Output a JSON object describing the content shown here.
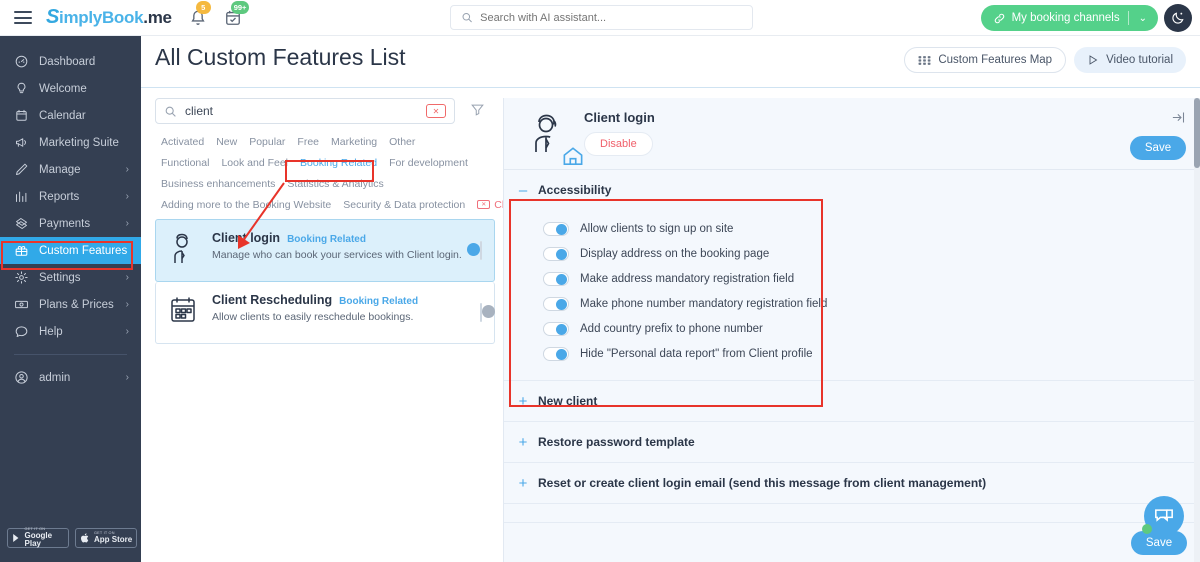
{
  "topbar": {
    "menu_icon": "hamburger-icon",
    "logo": {
      "s": "S",
      "blue": "imply",
      "dark": "Book",
      "blue2": ".",
      "dark2": "me"
    },
    "logo_text": "SimplyBook.me",
    "bell_icon": "bell-icon",
    "bell_badge": "5",
    "calendar_icon": "calendar-check-icon",
    "calendar_badge": "99+",
    "search": {
      "placeholder": "Search with AI assistant...",
      "value": "",
      "icon": "search-icon"
    },
    "booking_channels": {
      "label": "My booking channels",
      "icon": "link-icon",
      "chevron": "⌄"
    },
    "theme_toggle": {
      "icon": "moon-icon"
    }
  },
  "sidebar": {
    "items": [
      {
        "label": "Dashboard",
        "icon": "speedometer-icon",
        "chevron": false,
        "active": false
      },
      {
        "label": "Welcome",
        "icon": "lightbulb-icon",
        "chevron": false,
        "active": false
      },
      {
        "label": "Calendar",
        "icon": "calendar-icon",
        "chevron": false,
        "active": false
      },
      {
        "label": "Marketing Suite",
        "icon": "megaphone-icon",
        "chevron": false,
        "active": false
      },
      {
        "label": "Manage",
        "icon": "pencil-icon",
        "chevron": true,
        "active": false
      },
      {
        "label": "Reports",
        "icon": "bar-chart-icon",
        "chevron": true,
        "active": false
      },
      {
        "label": "Payments",
        "icon": "money-icon",
        "chevron": true,
        "active": false
      },
      {
        "label": "Custom Features",
        "icon": "gift-icon",
        "chevron": false,
        "active": true
      },
      {
        "label": "Settings",
        "icon": "gear-icon",
        "chevron": true,
        "active": false
      },
      {
        "label": "Plans & Prices",
        "icon": "banknote-icon",
        "chevron": true,
        "active": false
      },
      {
        "label": "Help",
        "icon": "chat-icon",
        "chevron": true,
        "active": false
      }
    ],
    "account": {
      "label": "admin",
      "icon": "user-circle-icon",
      "chevron": true
    },
    "stores": [
      {
        "small": "GET IT ON",
        "big": "Google Play",
        "icon": "google-play-icon"
      },
      {
        "small": "GET IT ON",
        "big": "App Store",
        "icon": "apple-icon"
      }
    ]
  },
  "page": {
    "title": "All Custom Features List",
    "buttons": [
      {
        "label": "Custom Features Map",
        "icon": "grid-icon",
        "style": "white"
      },
      {
        "label": "Video tutorial",
        "icon": "play-icon",
        "style": "lblue"
      }
    ]
  },
  "left_panel": {
    "search": {
      "value": "client",
      "placeholder": "",
      "icon": "search-icon",
      "clear_icon": "clear-icon"
    },
    "filter_icon": "filter-icon",
    "tag_rows": [
      [
        {
          "label": "Activated",
          "active": false
        },
        {
          "label": "New",
          "active": false
        },
        {
          "label": "Popular",
          "active": false
        },
        {
          "label": "Free",
          "active": false
        },
        {
          "label": "Marketing",
          "active": false
        },
        {
          "label": "Other",
          "active": false
        }
      ],
      [
        {
          "label": "Functional",
          "active": false
        },
        {
          "label": "Look and Feel",
          "active": false
        },
        {
          "label": "Booking Related",
          "active": true
        },
        {
          "label": "For development",
          "active": false
        }
      ],
      [
        {
          "label": "Business enhancements",
          "active": false
        },
        {
          "label": "Statistics & Analytics",
          "active": false
        }
      ],
      [
        {
          "label": "Adding more to the Booking Website",
          "active": false
        },
        {
          "label": "Security & Data protection",
          "active": false
        },
        {
          "label": "Clean",
          "active": false,
          "clean": true
        }
      ]
    ],
    "cards": [
      {
        "title": "Client login",
        "tag": "Booking Related",
        "desc": "Manage who can book your services with Client login.",
        "icon": "client-login-icon",
        "enabled": true,
        "selected": true
      },
      {
        "title": "Client Rescheduling",
        "tag": "Booking Related",
        "desc": "Allow clients to easily reschedule bookings.",
        "icon": "calendar-edit-icon",
        "enabled": false,
        "selected": false
      }
    ]
  },
  "detail_panel": {
    "icon": "client-login-icon",
    "title": "Client login",
    "disable_label": "Disable",
    "save_label": "Save",
    "collapse_icon": "collapse-right-icon",
    "footer_save_label": "Save",
    "sections": [
      {
        "title": "Accessibility",
        "expanded": true,
        "sign": "–",
        "options": [
          {
            "label": "Allow clients to sign up on site",
            "enabled": true
          },
          {
            "label": "Display address on the booking page",
            "enabled": true
          },
          {
            "label": "Make address mandatory registration field",
            "enabled": true
          },
          {
            "label": "Make phone number mandatory registration field",
            "enabled": true
          },
          {
            "label": "Add country prefix to phone number",
            "enabled": true
          },
          {
            "label": "Hide \"Personal data report\" from Client profile",
            "enabled": true
          }
        ]
      },
      {
        "title": "New client",
        "expanded": false,
        "sign": "+",
        "options": []
      },
      {
        "title": "Restore password template",
        "expanded": false,
        "sign": "+",
        "options": []
      },
      {
        "title": "Reset or create client login email (send this message from client management)",
        "expanded": false,
        "sign": "+",
        "options": []
      }
    ]
  },
  "chat_widget": {
    "icon": "chat-bubbles-icon",
    "online": true
  },
  "colors": {
    "accent_blue": "#4aa8e8",
    "sidebar_bg": "#343f52",
    "sidebar_active": "#31a9e8",
    "green": "#54d18a",
    "red_annotation": "#e8342a",
    "danger": "#f0606b"
  }
}
